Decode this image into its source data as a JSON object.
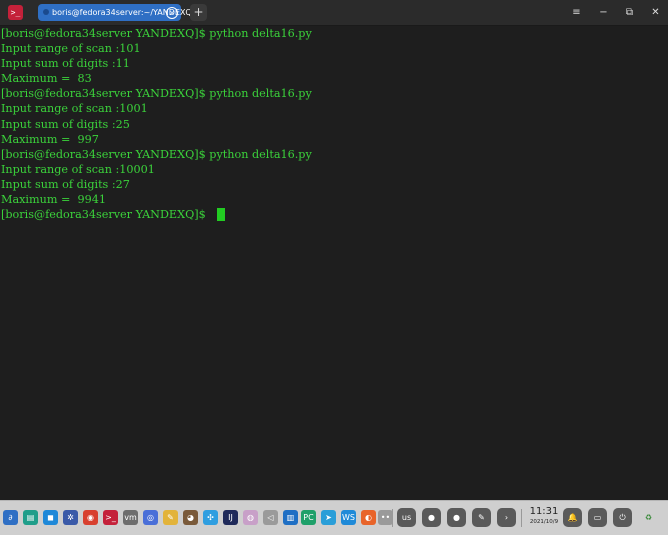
{
  "titlebar": {
    "tab_title": "boris@fedora34server:~/YANDEXQ",
    "tab_close": "×",
    "new_tab": "+",
    "menu_glyph": "≡",
    "minimize_glyph": "−",
    "restore_glyph": "⧉",
    "close_glyph": "✕",
    "app_glyph": ">_"
  },
  "terminal": {
    "lines": [
      "[boris@fedora34server YANDEXQ]$ python delta16.py",
      "Input range of scan :101",
      "Input sum of digits :11",
      "Maximum =  83",
      "[boris@fedora34server YANDEXQ]$ python delta16.py",
      "Input range of scan :1001",
      "Input sum of digits :25",
      "Maximum =  997",
      "[boris@fedora34server YANDEXQ]$ python delta16.py",
      "Input range of scan :10001",
      "Input sum of digits :27",
      "Maximum =  9941",
      "[boris@fedora34server YANDEXQ]$ "
    ],
    "text_color": "#3bd23b",
    "background": "#1e1e1e"
  },
  "taskbar": {
    "apps": [
      {
        "name": "launcher-icon",
        "glyph": "∂",
        "color": "#2f6fc4"
      },
      {
        "name": "file-manager-icon",
        "glyph": "▤",
        "color": "#1f9e8a"
      },
      {
        "name": "app-store-icon",
        "glyph": "◼",
        "color": "#1e88d8"
      },
      {
        "name": "settings-icon",
        "glyph": "✲",
        "color": "#3a5aa8"
      },
      {
        "name": "chrome-icon",
        "glyph": "◉",
        "color": "#d8402f"
      },
      {
        "name": "terminal-icon",
        "glyph": ">_",
        "color": "#c4213a"
      },
      {
        "name": "vm-icon",
        "glyph": "vm",
        "color": "#6d6d6d"
      },
      {
        "name": "remote-icon",
        "glyph": "◎",
        "color": "#4a6fd8"
      },
      {
        "name": "notes-icon",
        "glyph": "✎",
        "color": "#e2b33a"
      },
      {
        "name": "gimp-icon",
        "glyph": "◕",
        "color": "#7a5a3a"
      },
      {
        "name": "screenshot-icon",
        "glyph": "✣",
        "color": "#2f9ee0"
      },
      {
        "name": "intellij-icon",
        "glyph": "IJ",
        "color": "#1f2a5a"
      },
      {
        "name": "music-icon",
        "glyph": "◍",
        "color": "#c8a0c8"
      },
      {
        "name": "back-arrow-icon",
        "glyph": "◁",
        "color": "#9a9a9a"
      },
      {
        "name": "trello-icon",
        "glyph": "▥",
        "color": "#1f6fc4"
      },
      {
        "name": "pycharm-icon",
        "glyph": "PC",
        "color": "#1fa06a"
      },
      {
        "name": "telegram-icon",
        "glyph": "➤",
        "color": "#2a9ed8"
      },
      {
        "name": "webstorm-icon",
        "glyph": "WS",
        "color": "#1f8ad8"
      },
      {
        "name": "firefox-icon",
        "glyph": "◐",
        "color": "#e8642a"
      },
      {
        "name": "overflow-dots-icon",
        "glyph": "••",
        "color": "#9a9a9a"
      }
    ],
    "tray": [
      {
        "name": "keyboard-layout-button",
        "glyph": "us"
      },
      {
        "name": "tray-app-button-1",
        "glyph": "●"
      },
      {
        "name": "tray-app-button-2",
        "glyph": "●"
      },
      {
        "name": "pen-tool-button",
        "glyph": "✎"
      },
      {
        "name": "expand-tray-button",
        "glyph": "›"
      }
    ],
    "clock_time": "11:31",
    "clock_date": "2021/10/9",
    "right_buttons": [
      {
        "name": "notification-bell-button",
        "glyph": "🔔"
      },
      {
        "name": "multitask-button",
        "glyph": "▭"
      },
      {
        "name": "power-button",
        "glyph": "⏻"
      },
      {
        "name": "trash-icon",
        "glyph": "♻"
      }
    ]
  }
}
